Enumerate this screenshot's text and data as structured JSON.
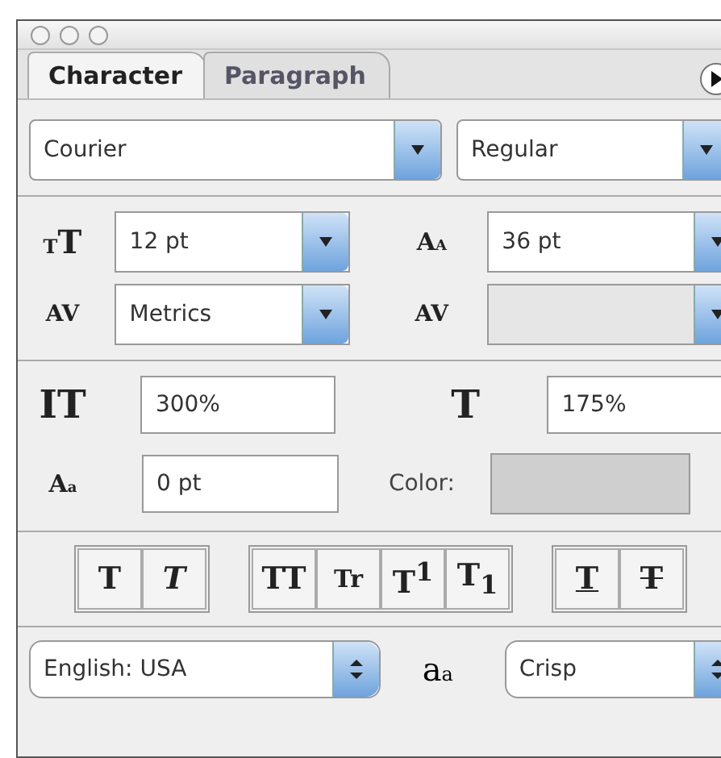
{
  "tabs": [
    {
      "label": "Character",
      "selected": true
    },
    {
      "label": "Paragraph",
      "selected": false
    }
  ],
  "font": {
    "family": "Courier",
    "style": "Regular"
  },
  "metrics": [
    {
      "kind": "size",
      "glyph": "TT",
      "value": "12 pt",
      "disabled": false
    },
    {
      "kind": "leading",
      "glyph": "AA",
      "value": "36 pt",
      "disabled": false
    },
    {
      "kind": "kerning",
      "glyph": "AV",
      "value": "Metrics",
      "disabled": false
    },
    {
      "kind": "tracking",
      "glyph": "AV",
      "disabled": true
    }
  ],
  "scales": [
    {
      "kind": "vertical",
      "glyph": "IT",
      "value": "300%"
    },
    {
      "kind": "horizontal",
      "glyph": "T",
      "value": "175%"
    },
    {
      "kind": "baseline",
      "glyph": "Aa",
      "value": "0 pt"
    }
  ],
  "color": {
    "label": "Color:"
  },
  "style_groups": [
    [
      {
        "kind": "bold",
        "label": "T",
        "on": false
      },
      {
        "kind": "italic",
        "label": "T",
        "on": false
      }
    ],
    [
      {
        "kind": "caps",
        "label": "TT",
        "on": false
      },
      {
        "kind": "smallcaps",
        "label": "Tr",
        "on": false
      },
      {
        "kind": "super",
        "label": "T$^{1}$",
        "on": false
      },
      {
        "kind": "sub",
        "label": "T$_{1}$",
        "on": false
      }
    ],
    [
      {
        "kind": "underline",
        "label": "T",
        "on": false
      },
      {
        "kind": "strike",
        "label": "T",
        "on": false
      }
    ]
  ],
  "language": "English: USA",
  "antialias": {
    "glyph": "aa",
    "value": "Crisp"
  }
}
